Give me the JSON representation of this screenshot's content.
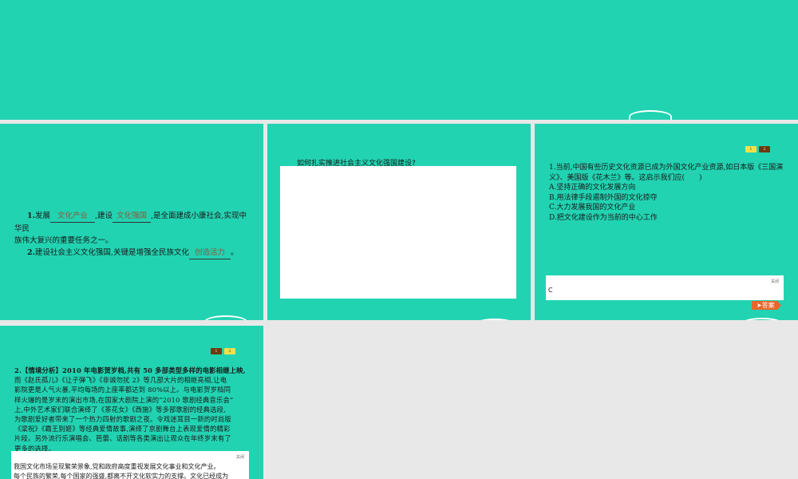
{
  "slide2": {
    "line1_num": "1.",
    "line1_a": "发展",
    "blank1": "文化产业",
    "line1_b": ",建设",
    "blank2": "文化强国",
    "line1_c": ",是全面建成小康社会,实现中华民",
    "line1_d": "族伟大复兴的重要任务之一。",
    "line2_num": "2.",
    "line2_a": "建设社会主义文化强国,关键是增强全民族文化",
    "blank3": "创造活力",
    "line2_b": "。"
  },
  "slide3": {
    "question": "如何扎实推进社会主义文化强国建设?"
  },
  "slide4": {
    "pager": [
      "1",
      "2"
    ],
    "q_lines": [
      "1.当前,中国有些历史文化资源已成为外国文化产业资源,如日本版《三国演",
      "义》、美国版《花木兰》等。这启示我们应(　　)",
      "A.坚持正确的文化发展方向",
      "B.用法律手段遏制外国的文化掠夺",
      "C.大力发展我国的文化产业",
      "D.把文化建设作为当前的中心工作"
    ],
    "close_label": "关闭",
    "answer_value": "C",
    "answer_button": "答案"
  },
  "slide5": {
    "pager": [
      "1",
      "2"
    ],
    "q_lines": [
      "2.【情境分析】2010 年电影贺岁档,共有 50 多部类型多样的电影相继上映,",
      "而《赵氏孤儿》《让子弹飞》《非诚勿扰 2》等几部大片的相继亮相,让电",
      "影院更是人气火暴,平均每场的上座率都达到 80%以上。与电影贺岁档同",
      "样火爆的是岁末的演出市场,在国家大剧院上演的“2010 歌剧经典音乐会”",
      "上,中外艺术家们联合演绎了《茶花女》《西施》等多部歌剧的经典选段,",
      "为歌剧爱好者带来了一个热力四射的歌剧之夜。令戏迷耳目一新的时尚版",
      "《梁祝》《霸王别姬》等经典爱情故事,演绎了京剧舞台上表现爱情的精彩",
      "片段。另外流行乐演唱会、芭蕾、话剧等各类演出让观众在年终岁末有了",
      "更多的选择。"
    ],
    "close_label": "关闭",
    "answer_lines": [
      "我国文化市场呈现繁荣景象,党和政府高度重视发展文化事业和文化产业。",
      "每个民族的繁荣,每个国家的强盛,都离不开文化软实力的支撑。文化已经成为"
    ]
  }
}
